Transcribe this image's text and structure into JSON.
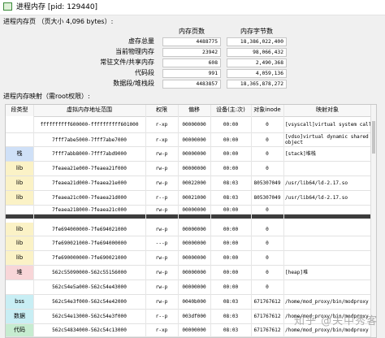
{
  "window": {
    "title": "进程内存 [pid: 129440]",
    "icon": "app-window-icon"
  },
  "summary": {
    "section_title": "进程内存页 （页大小 4,096 bytes）:",
    "col_pages": "内存页数",
    "col_bytes": "内存字节数",
    "rows": [
      {
        "label": "虚存总量",
        "pages": "4488775",
        "bytes": "18,386,022,400"
      },
      {
        "label": "当前物理内存",
        "pages": "23942",
        "bytes": "98,066,432"
      },
      {
        "label": "常驻文件/共享内存",
        "pages": "608",
        "bytes": "2,490,368"
      },
      {
        "label": "代码段",
        "pages": "991",
        "bytes": "4,059,136"
      },
      {
        "label": "数据段/堆栈段",
        "pages": "4483857",
        "bytes": "18,365,878,272"
      }
    ]
  },
  "mapping": {
    "section_title": "进程内存映射（需root权限）:",
    "headers": [
      "段类型",
      "虚拟内存地址范围",
      "权限",
      "偏移",
      "设备(主:次)",
      "对象inode",
      "映射对象"
    ],
    "rows": [
      {
        "seg": "",
        "addr": "ffffffffff600000-ffffffffff601000",
        "perm": "r-xp",
        "off": "00000000",
        "dev": "00:00",
        "inode": "0",
        "obj": "[vsyscall]virtual system call",
        "color": "#ffffff"
      },
      {
        "seg": "",
        "addr": "7fff7abe5000-7fff7abe7000",
        "perm": "r-xp",
        "off": "00000000",
        "dev": "00:00",
        "inode": "0",
        "obj": "[vdso]virtual dynamic shared object",
        "color": "#ffffff"
      },
      {
        "seg": "栈",
        "addr": "7fff7abb8000-7fff7abd9000",
        "perm": "rw-p",
        "off": "00000000",
        "dev": "00:00",
        "inode": "0",
        "obj": "[stack]堆栈",
        "color": "#cfe0f7"
      },
      {
        "seg": "lib",
        "addr": "7feaea21e000-7feaea21f000",
        "perm": "rw-p",
        "off": "00000000",
        "dev": "00:00",
        "inode": "0",
        "obj": "",
        "color": "#fbf2c6"
      },
      {
        "seg": "lib",
        "addr": "7feaea21d000-7feaea21e000",
        "perm": "rw-p",
        "off": "00022000",
        "dev": "08:03",
        "inode": "805307049",
        "obj": "/usr/lib64/ld-2.17.so",
        "color": "#fbf2c6"
      },
      {
        "seg": "lib",
        "addr": "7feaea21c000-7feaea21d000",
        "perm": "r--p",
        "off": "00021000",
        "dev": "08:03",
        "inode": "805307049",
        "obj": "/usr/lib64/ld-2.17.so",
        "color": "#fbf2c6"
      },
      {
        "seg": "",
        "addr": "7feaea218000-7feaea21c000",
        "perm": "rw-p",
        "off": "00000000",
        "dev": "00:00",
        "inode": "0",
        "obj": "",
        "color": "#ffffff"
      },
      {
        "seg": "lib",
        "addr": "7fe694000000-7fe694021000",
        "perm": "rw-p",
        "off": "00000000",
        "dev": "00:00",
        "inode": "0",
        "obj": "",
        "color": "#fbf2c6"
      },
      {
        "seg": "lib",
        "addr": "7fe690021000-7fe694000000",
        "perm": "---p",
        "off": "00000000",
        "dev": "00:00",
        "inode": "0",
        "obj": "",
        "color": "#fbf2c6"
      },
      {
        "seg": "lib",
        "addr": "7fe690000000-7fe690021000",
        "perm": "rw-p",
        "off": "00000000",
        "dev": "00:00",
        "inode": "0",
        "obj": "",
        "color": "#fbf2c6"
      },
      {
        "seg": "堆",
        "addr": "562c55090000-562c55156000",
        "perm": "rw-p",
        "off": "00000000",
        "dev": "00:00",
        "inode": "0",
        "obj": "[heap]堆",
        "color": "#f8d6d8"
      },
      {
        "seg": "",
        "addr": "562c54e5a000-562c54e43000",
        "perm": "rw-p",
        "off": "00000000",
        "dev": "00:00",
        "inode": "0",
        "obj": "",
        "color": "#ffffff"
      },
      {
        "seg": "bss",
        "addr": "562c54e3f000-562c54e42000",
        "perm": "rw-p",
        "off": "0040b000",
        "dev": "08:03",
        "inode": "671767612",
        "obj": "/home/mod_proxy/bin/modproxy",
        "color": "#c8eef4"
      },
      {
        "seg": "数据",
        "addr": "562c54e13000-562c54e3f000",
        "perm": "r--p",
        "off": "003df000",
        "dev": "08:03",
        "inode": "671767612",
        "obj": "/home/mod_proxy/bin/modproxy",
        "color": "#c8eef4"
      },
      {
        "seg": "代码",
        "addr": "562c54834000-562c54c13000",
        "perm": "r-xp",
        "off": "00000000",
        "dev": "08:03",
        "inode": "671767612",
        "obj": "/home/mod_proxy/bin/modproxy",
        "color": "#c6ecd0"
      }
    ]
  },
  "watermark": "知乎 @关中秀客"
}
